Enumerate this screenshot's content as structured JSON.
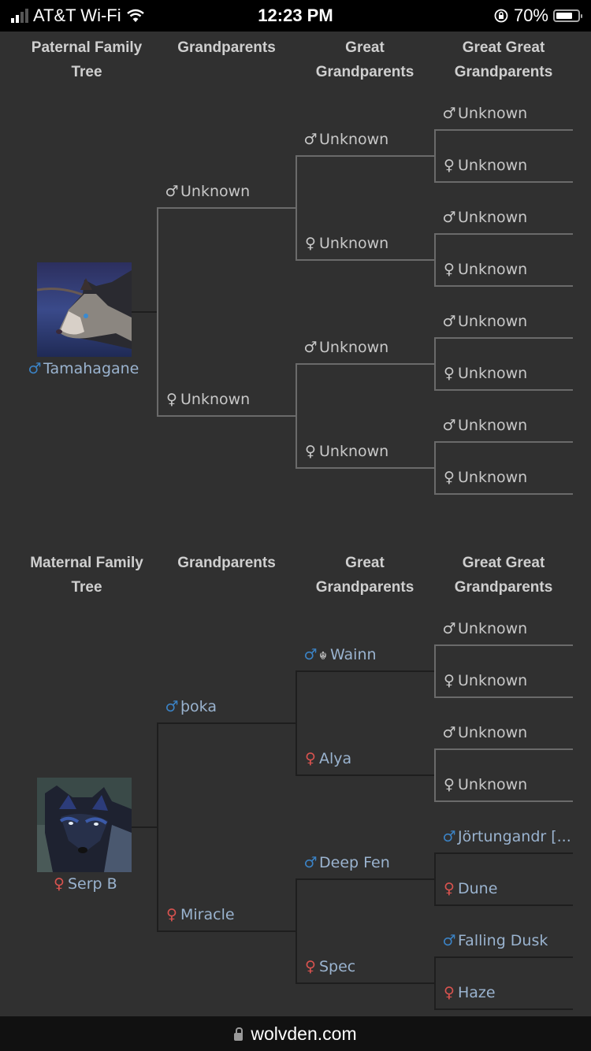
{
  "status_bar": {
    "carrier": "AT&T Wi-Fi",
    "time": "12:23 PM",
    "battery": "70%",
    "battery_level": 0.7,
    "icons": [
      "signal-icon",
      "wifi-icon",
      "rotation-lock-icon",
      "battery-icon"
    ]
  },
  "headers": {
    "col_generations": [
      "Grandparents",
      "Great Grandparents",
      "Great Great Grandparents"
    ],
    "great": "Great",
    "grandparents": "Grandparents",
    "great_great": "Great Great"
  },
  "paternal": {
    "title_line1": "Paternal Family",
    "title_line2": "Tree",
    "root": {
      "name": "Tamahagane",
      "sex": "male",
      "symbol": "♂"
    },
    "gen1": [
      {
        "name": "Unknown",
        "symbol": "♂",
        "known": false
      },
      {
        "name": "Unknown",
        "symbol": "♀",
        "known": false
      }
    ],
    "gen2": [
      {
        "name": "Unknown",
        "symbol": "♂",
        "known": false
      },
      {
        "name": "Unknown",
        "symbol": "♀",
        "known": false
      },
      {
        "name": "Unknown",
        "symbol": "♂",
        "known": false
      },
      {
        "name": "Unknown",
        "symbol": "♀",
        "known": false
      }
    ],
    "gen3": [
      {
        "name": "Unknown",
        "symbol": "♂",
        "known": false
      },
      {
        "name": "Unknown",
        "symbol": "♀",
        "known": false
      },
      {
        "name": "Unknown",
        "symbol": "♂",
        "known": false
      },
      {
        "name": "Unknown",
        "symbol": "♀",
        "known": false
      },
      {
        "name": "Unknown",
        "symbol": "♂",
        "known": false
      },
      {
        "name": "Unknown",
        "symbol": "♀",
        "known": false
      },
      {
        "name": "Unknown",
        "symbol": "♂",
        "known": false
      },
      {
        "name": "Unknown",
        "symbol": "♀",
        "known": false
      }
    ]
  },
  "maternal": {
    "title_line1": "Maternal Family",
    "title_line2": "Tree",
    "root": {
      "name": "Serp B",
      "sex": "female",
      "symbol": "♀"
    },
    "gen1": [
      {
        "name": "þoka",
        "symbol": "♂",
        "known": true
      },
      {
        "name": "Miracle",
        "symbol": "♀",
        "known": true
      }
    ],
    "gen2": [
      {
        "name": "Wainn",
        "symbol": "♂",
        "known": true,
        "badge": "☬"
      },
      {
        "name": "Alya",
        "symbol": "♀",
        "known": true
      },
      {
        "name": "Deep Fen",
        "symbol": "♂",
        "known": true
      },
      {
        "name": "Spec",
        "symbol": "♀",
        "known": true
      }
    ],
    "gen3": [
      {
        "name": "Unknown",
        "symbol": "♂",
        "known": false
      },
      {
        "name": "Unknown",
        "symbol": "♀",
        "known": false
      },
      {
        "name": "Unknown",
        "symbol": "♂",
        "known": false
      },
      {
        "name": "Unknown",
        "symbol": "♀",
        "known": false
      },
      {
        "name": "Jörtungandr [...",
        "symbol": "♂",
        "known": true
      },
      {
        "name": "Dune",
        "symbol": "♀",
        "known": true
      },
      {
        "name": "Falling Dusk",
        "symbol": "♂",
        "known": true
      },
      {
        "name": "Haze",
        "symbol": "♀",
        "known": true
      }
    ]
  },
  "url_bar": {
    "domain": "wolvden.com"
  },
  "colors": {
    "male": "#3b82c4",
    "female": "#d9534f",
    "known_name": "#9ab3cf",
    "unknown": "#c8c8c8",
    "background": "#303030"
  }
}
